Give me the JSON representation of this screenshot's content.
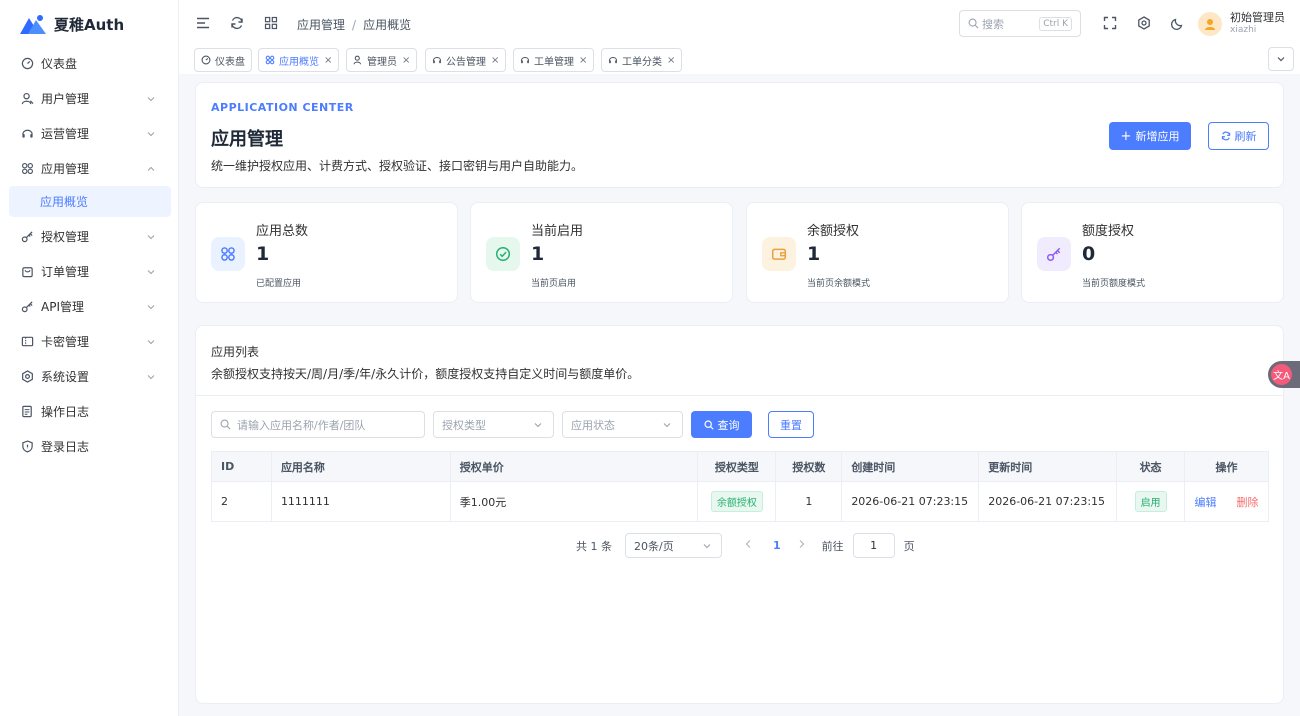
{
  "brand": {
    "name": "夏稚Auth"
  },
  "sidebar": {
    "items": [
      {
        "label": "仪表盘"
      },
      {
        "label": "用户管理"
      },
      {
        "label": "运营管理"
      },
      {
        "label": "应用管理"
      },
      {
        "label": "授权管理"
      },
      {
        "label": "订单管理"
      },
      {
        "label": "API管理"
      },
      {
        "label": "卡密管理"
      },
      {
        "label": "系统设置"
      },
      {
        "label": "操作日志"
      },
      {
        "label": "登录日志"
      }
    ],
    "sub_active": "应用概览"
  },
  "header": {
    "breadcrumb": [
      "应用管理",
      "应用概览"
    ],
    "search_placeholder": "搜索",
    "search_shortcut": "Ctrl K",
    "user_name": "初始管理员",
    "user_id": "xiazhi"
  },
  "tabs": [
    {
      "label": "仪表盘",
      "closable": false
    },
    {
      "label": "应用概览",
      "closable": true,
      "active": true
    },
    {
      "label": "管理员",
      "closable": true
    },
    {
      "label": "公告管理",
      "closable": true
    },
    {
      "label": "工单管理",
      "closable": true
    },
    {
      "label": "工单分类",
      "closable": true
    }
  ],
  "hero": {
    "eyebrow": "APPLICATION CENTER",
    "title": "应用管理",
    "desc": "统一维护授权应用、计费方式、授权验证、接口密钥与用户自助能力。",
    "add_button": "新增应用",
    "refresh_button": "刷新"
  },
  "stats": [
    {
      "label": "应用总数",
      "value": "1",
      "sub": "已配置应用",
      "color": "#4c7dff",
      "bg": "#eaf1ff"
    },
    {
      "label": "当前启用",
      "value": "1",
      "sub": "当前页启用",
      "color": "#27b06f",
      "bg": "#e6f7ee"
    },
    {
      "label": "余额授权",
      "value": "1",
      "sub": "当前页余额模式",
      "color": "#e6a23c",
      "bg": "#fdf1e0"
    },
    {
      "label": "额度授权",
      "value": "0",
      "sub": "当前页额度模式",
      "color": "#8b5cf6",
      "bg": "#f1ebfe"
    }
  ],
  "list": {
    "title": "应用列表",
    "desc": "余额授权支持按天/周/月/季/年/永久计价，额度授权支持自定义时间与额度单价。",
    "filters": {
      "keyword_placeholder": "请输入应用名称/作者/团队",
      "type_placeholder": "授权类型",
      "status_placeholder": "应用状态",
      "query_button": "查询",
      "reset_button": "重置"
    },
    "columns": [
      "ID",
      "应用名称",
      "授权单价",
      "授权类型",
      "授权数",
      "创建时间",
      "更新时间",
      "状态",
      "操作"
    ],
    "rows": [
      {
        "id": "2",
        "name": "1111111",
        "price": "季1.00元",
        "type": "余额授权",
        "count": "1",
        "created": "2026-06-21 07:23:15",
        "updated": "2026-06-21 07:23:15",
        "status": "启用",
        "edit": "编辑",
        "delete": "删除"
      }
    ],
    "pager": {
      "total": "共 1 条",
      "page_size": "20条/页",
      "current": "1",
      "goto_label": "前往",
      "goto_value": "1",
      "page_unit": "页"
    }
  },
  "floater": {
    "label": "文A"
  }
}
